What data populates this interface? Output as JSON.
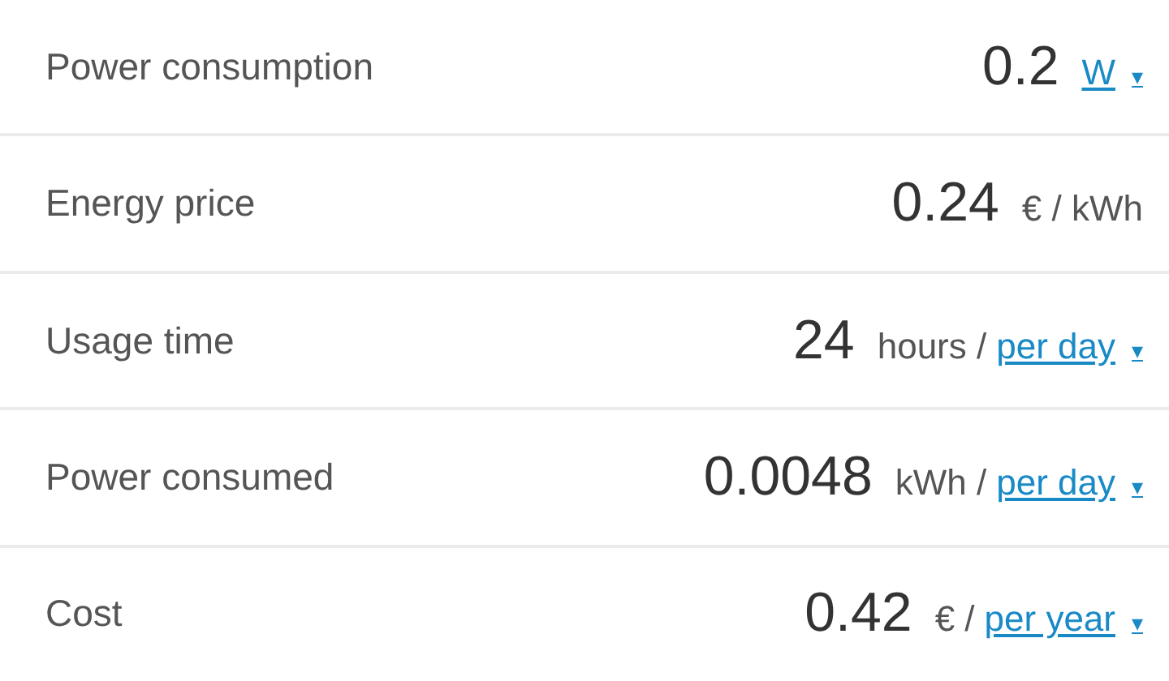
{
  "rows": [
    {
      "label": "Power consumption",
      "value": "0.2",
      "dropdown": {
        "text": "W",
        "arrow": "▾"
      }
    },
    {
      "label": "Energy price",
      "value": "0.24",
      "unit": "€ / kWh"
    },
    {
      "label": "Usage time",
      "value": "24",
      "unit": "hours /",
      "dropdown": {
        "text": "per day",
        "arrow": "▾"
      }
    },
    {
      "label": "Power consumed",
      "value": "0.0048",
      "unit": "kWh /",
      "dropdown": {
        "text": "per day",
        "arrow": "▾"
      }
    },
    {
      "label": "Cost",
      "value": "0.42",
      "unit": "€ /",
      "dropdown": {
        "text": "per year",
        "arrow": "▾"
      }
    }
  ]
}
